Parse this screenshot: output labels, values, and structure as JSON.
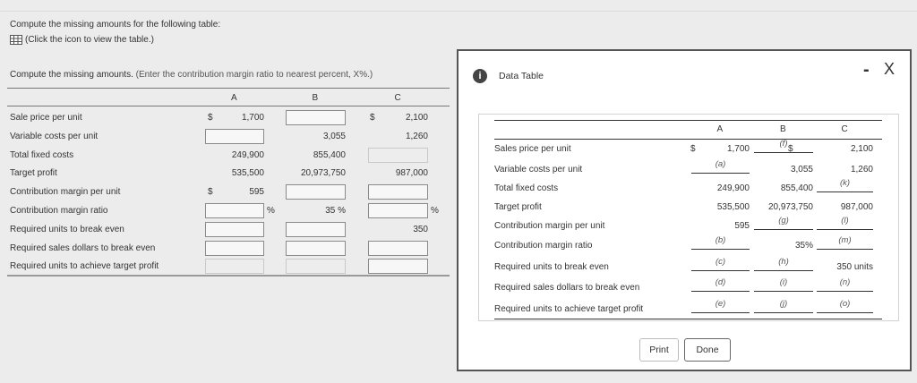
{
  "instructions": {
    "line1": "Compute the missing amounts for the following table:",
    "line2": "(Click the icon to view the table.)"
  },
  "prompt": {
    "text": "Compute the missing amounts.",
    "hint": "(Enter the contribution margin ratio to nearest percent, X%.)"
  },
  "columns": [
    "A",
    "B",
    "C"
  ],
  "left_rows": [
    {
      "label": "Sale price per unit",
      "cells": [
        {
          "t": "val",
          "d": "$",
          "v": "1,700"
        },
        {
          "t": "in"
        },
        {
          "t": "val",
          "d": "$",
          "v": "2,100"
        }
      ]
    },
    {
      "label": "Variable costs per unit",
      "cells": [
        {
          "t": "in"
        },
        {
          "t": "val",
          "v": "3,055"
        },
        {
          "t": "val",
          "v": "1,260"
        }
      ]
    },
    {
      "label": "Total fixed costs",
      "cells": [
        {
          "t": "val",
          "v": "249,900"
        },
        {
          "t": "val",
          "v": "855,400"
        },
        {
          "t": "dis"
        }
      ]
    },
    {
      "label": "Target profit",
      "cells": [
        {
          "t": "val",
          "v": "535,500"
        },
        {
          "t": "val",
          "v": "20,973,750"
        },
        {
          "t": "val",
          "v": "987,000"
        }
      ]
    },
    {
      "label": "Contribution margin per unit",
      "cells": [
        {
          "t": "val",
          "d": "$",
          "v": "595"
        },
        {
          "t": "in"
        },
        {
          "t": "in"
        }
      ]
    },
    {
      "label": "Contribution margin ratio",
      "cells": [
        {
          "t": "in",
          "pct": "%"
        },
        {
          "t": "val",
          "v": "35 %"
        },
        {
          "t": "in",
          "pct": "%"
        }
      ]
    },
    {
      "label": "Required units to break even",
      "cells": [
        {
          "t": "in"
        },
        {
          "t": "in"
        },
        {
          "t": "val",
          "v": "350"
        }
      ]
    },
    {
      "label": "Required sales dollars to break even",
      "cells": [
        {
          "t": "in"
        },
        {
          "t": "in"
        },
        {
          "t": "in"
        }
      ]
    },
    {
      "label": "Required units to achieve target profit",
      "cells": [
        {
          "t": "dis"
        },
        {
          "t": "dis"
        },
        {
          "t": "in"
        }
      ]
    }
  ],
  "modal": {
    "title": "Data Table",
    "minimize": "-",
    "close": "X",
    "print": "Print",
    "done": "Done",
    "rows": [
      {
        "label": "Sales price per unit",
        "cells": [
          {
            "t": "val",
            "d": "$",
            "v": "1,700"
          },
          {
            "t": "ul",
            "v": "(f)"
          },
          {
            "t": "val",
            "d": "$",
            "v": "2,100"
          }
        ]
      },
      {
        "label": "Variable costs per unit",
        "cells": [
          {
            "t": "ul",
            "v": "(a)"
          },
          {
            "t": "val",
            "v": "3,055"
          },
          {
            "t": "val",
            "v": "1,260"
          }
        ]
      },
      {
        "label": "Total fixed costs",
        "cells": [
          {
            "t": "val",
            "v": "249,900"
          },
          {
            "t": "val",
            "v": "855,400"
          },
          {
            "t": "ul",
            "v": "(k)"
          }
        ]
      },
      {
        "label": "Target profit",
        "cells": [
          {
            "t": "val",
            "v": "535,500"
          },
          {
            "t": "val",
            "v": "20,973,750"
          },
          {
            "t": "val",
            "v": "987,000"
          }
        ]
      },
      {
        "label": "Contribution margin per unit",
        "cells": [
          {
            "t": "val",
            "v": "595"
          },
          {
            "t": "ul",
            "v": "(g)"
          },
          {
            "t": "ul",
            "v": "(l)"
          }
        ]
      },
      {
        "label": "Contribution margin ratio",
        "cells": [
          {
            "t": "ul",
            "v": "(b)"
          },
          {
            "t": "val",
            "v": "35%"
          },
          {
            "t": "ul",
            "v": "(m)"
          }
        ]
      },
      {
        "label": "Required units to break even",
        "cells": [
          {
            "t": "ul",
            "v": "(c)"
          },
          {
            "t": "ul",
            "v": "(h)"
          },
          {
            "t": "val",
            "v": "350 units"
          }
        ]
      },
      {
        "label": "Required sales dollars to break even",
        "cells": [
          {
            "t": "ul",
            "v": "(d)"
          },
          {
            "t": "ul",
            "v": "(i)"
          },
          {
            "t": "ul",
            "v": "(n)"
          }
        ]
      },
      {
        "label": "Required units to achieve target profit",
        "cells": [
          {
            "t": "ul",
            "v": "(e)"
          },
          {
            "t": "ul",
            "v": "(j)"
          },
          {
            "t": "ul",
            "v": "(o)"
          }
        ]
      }
    ]
  }
}
